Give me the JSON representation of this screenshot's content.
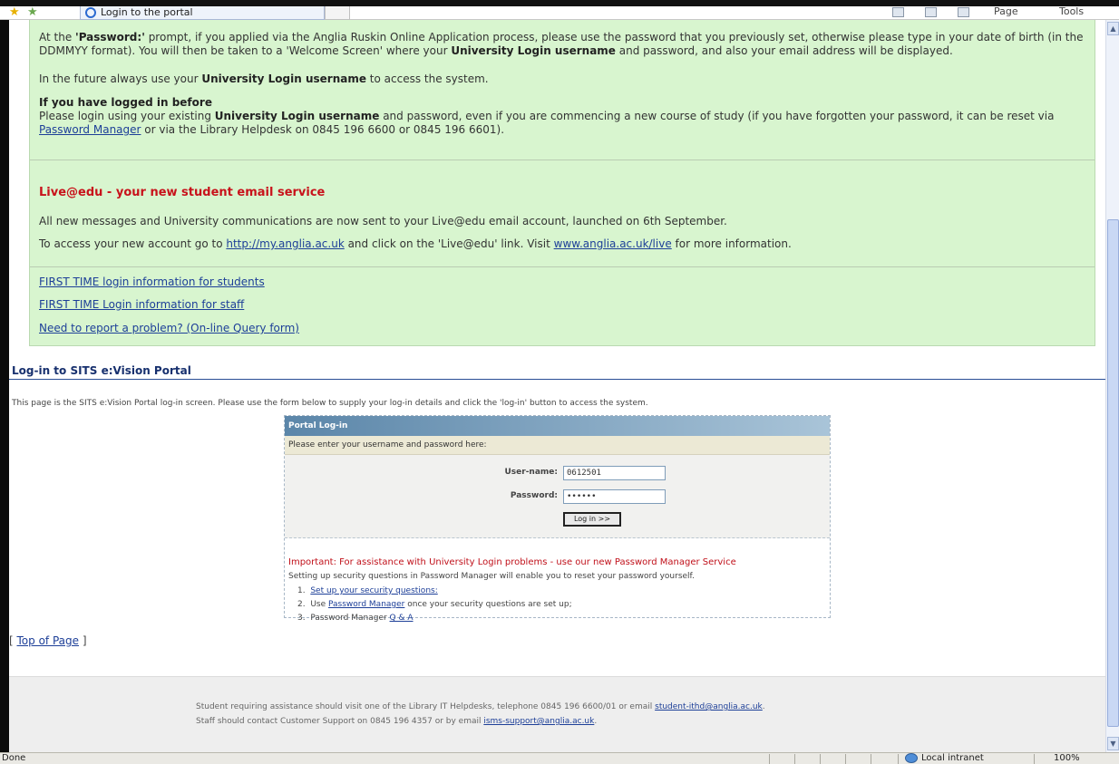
{
  "browser": {
    "tab_title": "Login to the portal",
    "page_menu": "Page",
    "tools_menu": "Tools",
    "status_text": "Done",
    "zone": "Local intranet",
    "zoom": "100%"
  },
  "info": {
    "password_para_1": "At the ",
    "password_para_bold": "'Password:'",
    "password_para_2": " prompt, if you applied via the Anglia Ruskin Online Application process, please use the password that you previously set, otherwise please type in your date of birth (in the DDMMYY format). You will then be taken to a 'Welcome Screen' where your ",
    "password_para_bold2": "University Login username",
    "password_para_3": " and password, and also your email address will be displayed.",
    "future_1": "In the future always use your ",
    "future_bold": "University Login username",
    "future_2": " to access the system.",
    "logged_heading": "If you have logged in before",
    "logged_1": "Please login using your existing ",
    "logged_bold": "University Login username",
    "logged_2": " and password, even if you are commencing a new course of study (if you have forgotten your password, it can be reset via ",
    "logged_link": "Password Manager",
    "logged_3": " or via the Library Helpdesk on 0845 196 6600 or 0845 196 6601).",
    "live_heading": "Live@edu - your new student email service",
    "live_para": "All new messages and University communications are now sent to your Live@edu email account, launched on 6th September.",
    "access_1": "To access your new account go to ",
    "access_link1": "http://my.anglia.ac.uk",
    "access_2": " and click on the 'Live@edu' link. Visit ",
    "access_link2": "www.anglia.ac.uk/live",
    "access_3": " for more information.",
    "links": [
      "FIRST TIME login information for students",
      "FIRST TIME Login information for staff",
      "Need to report a problem? (On-line Query form)"
    ]
  },
  "portal": {
    "section_title": "Log-in to SITS e:Vision Portal",
    "intro": "This page is the SITS e:Vision Portal log-in screen. Please use the form below to supply your log-in details and click the 'log-in' button to access the system.",
    "box_title": "Portal Log-in",
    "instruction": "Please enter your username and password here:",
    "username_label": "User-name:",
    "username_value": "0612501",
    "password_label": "Password:",
    "password_value": "••••••",
    "login_button": "Log in >>",
    "important": "Important: For assistance with University Login problems - use our new Password Manager Service",
    "setup_text": "Setting up security questions in Password Manager will enable you to reset your password yourself.",
    "step1_num": "1.",
    "step1_link": "Set up your security questions:",
    "step2_num": "2.",
    "step2_pre": "Use ",
    "step2_link": "Password Manager",
    "step2_post": " once your security questions are set up;",
    "step3_num": "3.",
    "step3_pre": "Password Manager ",
    "step3_link": "Q & A"
  },
  "top_of_page": {
    "open": "[ ",
    "link": "Top of Page",
    "close": " ]"
  },
  "footer": {
    "line1_pre": "Student requiring assistance should visit one of the Library IT Helpdesks, telephone 0845 196 6600/01 or email ",
    "line1_link": "student-ithd@anglia.ac.uk",
    "line1_post": ".",
    "line2_pre": "Staff should contact Customer Support on 0845 196 4357 or by email ",
    "line2_link": "isms-support@anglia.ac.uk",
    "line2_post": "."
  }
}
